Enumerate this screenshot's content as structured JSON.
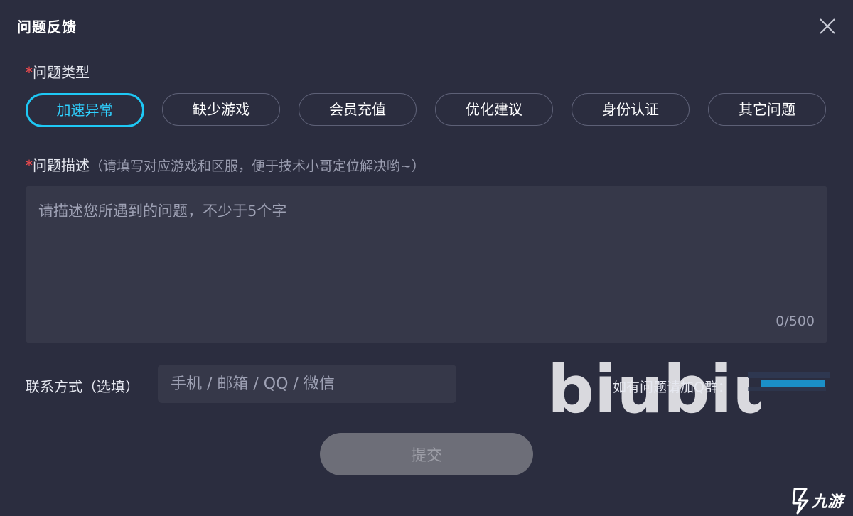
{
  "dialog": {
    "title": "问题反馈",
    "close_icon": "close-icon"
  },
  "problem_type": {
    "required_mark": "*",
    "label": "问题类型",
    "options": [
      {
        "label": "加速异常",
        "selected": true
      },
      {
        "label": "缺少游戏",
        "selected": false
      },
      {
        "label": "会员充值",
        "selected": false
      },
      {
        "label": "优化建议",
        "selected": false
      },
      {
        "label": "身份认证",
        "selected": false
      },
      {
        "label": "其它问题",
        "selected": false
      }
    ]
  },
  "description": {
    "required_mark": "*",
    "label": "问题描述",
    "hint": "（请填写对应游戏和区服，便于技术小哥定位解决哟~）",
    "placeholder": "请描述您所遇到的问题，不少于5个字",
    "value": "",
    "counter": "0/500"
  },
  "contact": {
    "label": "联系方式（选填）",
    "placeholder": "手机 / 邮箱 / QQ / 微信",
    "value": ""
  },
  "qq_group": {
    "text": "如有问题请加Q群："
  },
  "submit": {
    "label": "提交"
  },
  "watermarks": {
    "biubiu": "biubiu",
    "site": "九游"
  },
  "colors": {
    "background": "#2b2d3f",
    "accent": "#1ec8f5",
    "required": "#ff4d4f",
    "input_bg": "#363849",
    "submit_disabled": "#6d6e78"
  }
}
